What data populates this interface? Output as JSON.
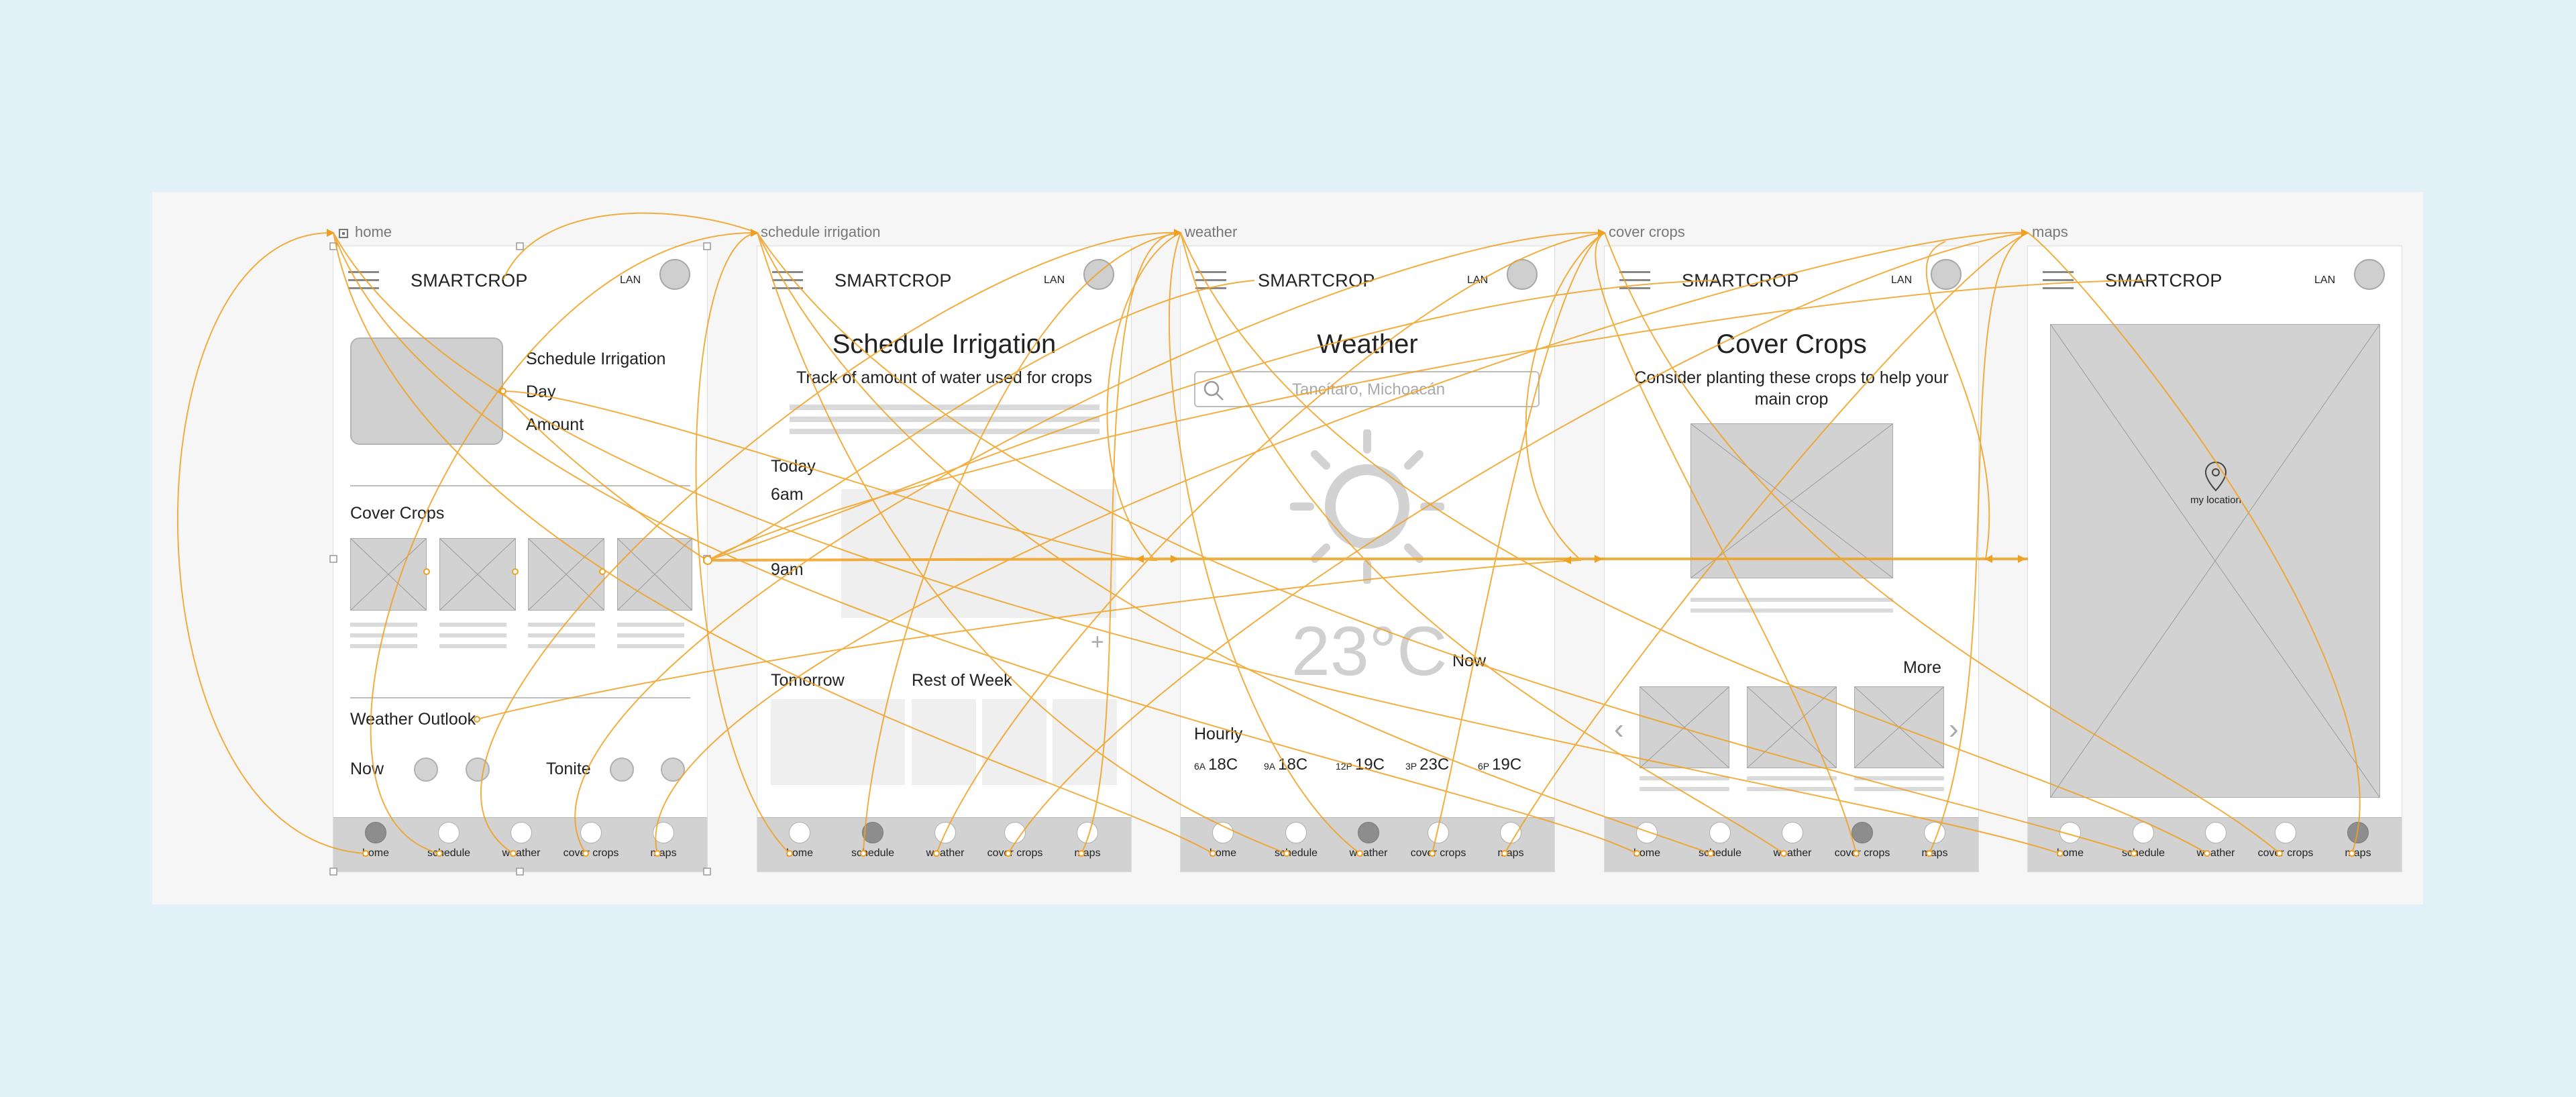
{
  "artboards": [
    "home",
    "schedule irrigation",
    "weather",
    "cover crops",
    "maps"
  ],
  "brand": "SMARTCROP",
  "lan": "LAN",
  "nav": [
    "home",
    "schedule",
    "weather",
    "cover crops",
    "maps"
  ],
  "home": {
    "schedule_title": "Schedule Irrigation",
    "day": "Day",
    "amount": "Amount",
    "cover_crops": "Cover Crops",
    "weather_outlook": "Weather Outlook",
    "now": "Now",
    "tonite": "Tonite"
  },
  "schedule": {
    "title": "Schedule Irrigation",
    "subtitle": "Track of amount of water used for crops",
    "today": "Today",
    "time1": "6am",
    "time2": "9am",
    "tomorrow": "Tomorrow",
    "rest_of_week": "Rest of Week"
  },
  "weather": {
    "title": "Weather",
    "search_placeholder": "Tancítaro, Michoacán",
    "temperature": "23°C",
    "now": "Now",
    "hourly_label": "Hourly",
    "hourly": [
      {
        "time": "6A",
        "temp": "18C"
      },
      {
        "time": "9A",
        "temp": "18C"
      },
      {
        "time": "12P",
        "temp": "19C"
      },
      {
        "time": "3P",
        "temp": "23C"
      },
      {
        "time": "6P",
        "temp": "19C"
      }
    ]
  },
  "covercrops": {
    "title": "Cover Crops",
    "subtitle": "Consider planting these crops to help your main crop",
    "more": "More"
  },
  "maps": {
    "my_location": "my location"
  },
  "colors": {
    "background": "#e2f0f7",
    "flow": "#f0a020",
    "placeholder": "#d0d0d0"
  }
}
